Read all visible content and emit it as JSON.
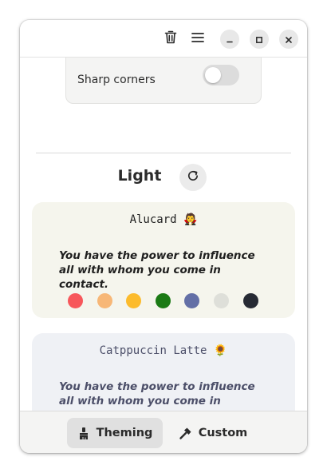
{
  "header": {
    "delete_icon": "trash-icon",
    "menu_icon": "hamburger-menu-icon",
    "minimize_icon": "minimize-icon",
    "maximize_icon": "maximize-icon",
    "close_icon": "close-icon"
  },
  "options": {
    "sharp_corners_label": "Sharp corners",
    "sharp_corners_enabled": false
  },
  "section": {
    "title": "Light",
    "refresh_icon": "refresh-icon"
  },
  "themes": [
    {
      "name": "Alucard 🧛",
      "quote": "You have the power to influence all with whom you come in contact.",
      "background": "#f5f5ed",
      "text_color": "#1f1f1f",
      "swatches": [
        "#f7575b",
        "#f7b777",
        "#fcbb2c",
        "#1b7a14",
        "#636fa6",
        "#dedfd9",
        "#262a34"
      ]
    },
    {
      "name": "Catppuccin Latte 🌻",
      "quote": "You have the power to influence all with whom you come in contact.",
      "background": "#eff1f5",
      "text_color": "#4c4f69",
      "swatches": [
        "#d20f39",
        "#fe640b",
        "#df8e1d",
        "#40a02b",
        "#1e66f5",
        "#ccd0da",
        "#4c4f69"
      ]
    }
  ],
  "bottom_tabs": [
    {
      "label": "Theming",
      "icon": "paintbrush-icon",
      "active": true
    },
    {
      "label": "Custom",
      "icon": "hammer-icon",
      "active": false
    }
  ],
  "colors": {
    "window_bg": "#ffffff",
    "active_tab_bg": "#e0e0e0",
    "bottom_bar_bg": "#f4f4f3"
  }
}
